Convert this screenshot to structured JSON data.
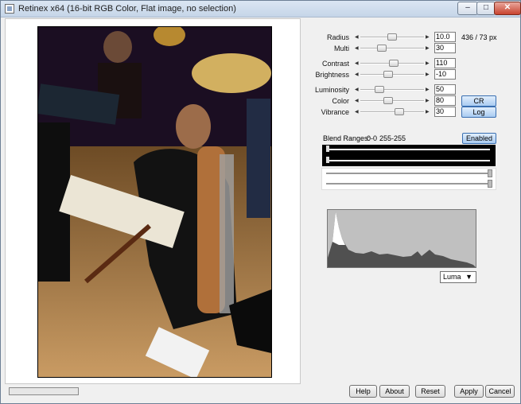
{
  "window": {
    "title": "Retinex x64 (16-bit RGB Color, Flat image, no selection)"
  },
  "titlebar_buttons": {
    "minimize": "–",
    "maximize": "□",
    "close": "✕"
  },
  "controls": [
    {
      "label": "Radius",
      "value": "10.0",
      "level": 0.45
    },
    {
      "label": "Multi",
      "value": "30",
      "level": 0.3
    },
    {
      "label": "Contrast",
      "value": "110",
      "level": 0.55
    },
    {
      "label": "Brightness",
      "value": "-10",
      "level": 0.45
    },
    {
      "label": "Luminosity",
      "value": "50",
      "level": 0.25
    },
    {
      "label": "Color",
      "value": "80",
      "level": 0.42
    },
    {
      "label": "Vibrance",
      "value": "30",
      "level": 0.6
    }
  ],
  "radius_info": "436 / 73 px",
  "buttons": {
    "cr": "CR",
    "log": "Log",
    "enabled": "Enabled",
    "help": "Help",
    "about": "About",
    "reset": "Reset",
    "apply": "Apply",
    "cancel": "Cancel"
  },
  "blend": {
    "label": "Blend Ranges:",
    "range1": "0-0",
    "range2": "255-255"
  },
  "histogram": {
    "channel": "Luma"
  },
  "progress": {
    "value": 0.0
  },
  "colors": {
    "accent": "#3a6fb1",
    "window_bg": "#f0f0f0",
    "titlebar": "#c5d5e8"
  }
}
